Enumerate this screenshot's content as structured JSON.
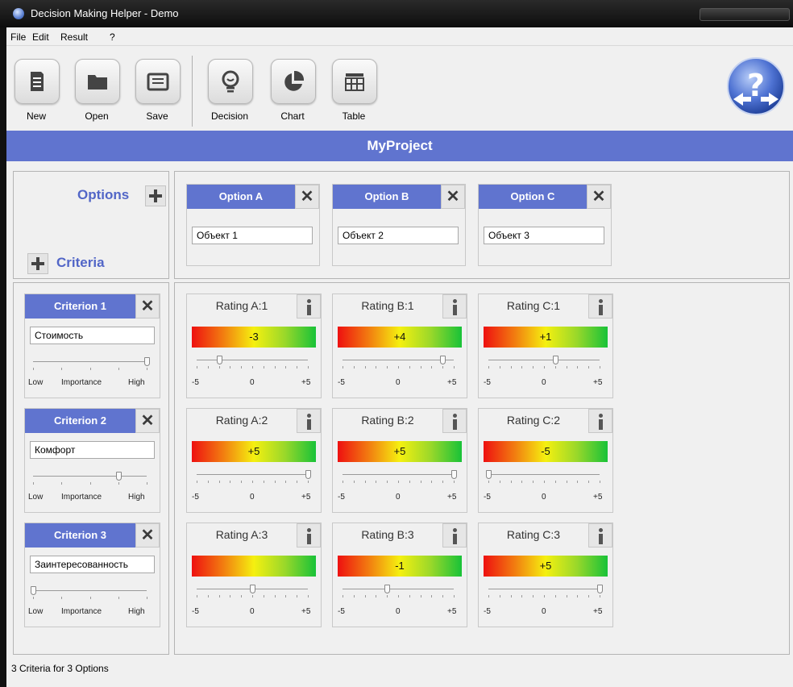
{
  "window": {
    "title": "Decision Making Helper - Demo"
  },
  "menu": [
    "File",
    "Edit",
    "Result",
    "?"
  ],
  "toolbar": {
    "buttons": [
      {
        "label": "New",
        "icon": "new-document-icon"
      },
      {
        "label": "Open",
        "icon": "folder-icon"
      },
      {
        "label": "Save",
        "icon": "save-icon"
      },
      {
        "label": "Decision",
        "icon": "lightbulb-icon"
      },
      {
        "label": "Chart",
        "icon": "pie-chart-icon"
      },
      {
        "label": "Table",
        "icon": "table-icon"
      }
    ],
    "help_icon": "help-icon"
  },
  "project": {
    "title": "MyProject"
  },
  "options_label": "Options",
  "criteria_label": "Criteria",
  "options": [
    {
      "header": "Option A",
      "name": "Объект 1"
    },
    {
      "header": "Option B",
      "name": "Объект 2"
    },
    {
      "header": "Option C",
      "name": "Объект 3"
    }
  ],
  "importance_labels": {
    "low": "Low",
    "mid": "Importance",
    "high": "High"
  },
  "criteria": [
    {
      "header": "Criterion 1",
      "name": "Стоимость",
      "importance": 1.0
    },
    {
      "header": "Criterion 2",
      "name": "Комфорт",
      "importance": 0.75
    },
    {
      "header": "Criterion 3",
      "name": "Заинтересованность",
      "importance": 0.0
    }
  ],
  "scale_labels": {
    "min": "-5",
    "mid": "0",
    "max": "+5"
  },
  "ratings": [
    [
      {
        "header": "Rating A:1",
        "value": -3,
        "label": "-3"
      },
      {
        "header": "Rating B:1",
        "value": 4,
        "label": "+4"
      },
      {
        "header": "Rating C:1",
        "value": 1,
        "label": "+1"
      }
    ],
    [
      {
        "header": "Rating A:2",
        "value": 5,
        "label": "+5"
      },
      {
        "header": "Rating B:2",
        "value": 5,
        "label": "+5"
      },
      {
        "header": "Rating C:2",
        "value": -5,
        "label": "-5"
      }
    ],
    [
      {
        "header": "Rating A:3",
        "value": 0,
        "label": ""
      },
      {
        "header": "Rating B:3",
        "value": -1,
        "label": "-1"
      },
      {
        "header": "Rating C:3",
        "value": 5,
        "label": "+5"
      }
    ]
  ],
  "status": "3 Criteria for 3 Options",
  "colors": {
    "accent": "#6074cf",
    "label_blue": "#5266c7"
  }
}
